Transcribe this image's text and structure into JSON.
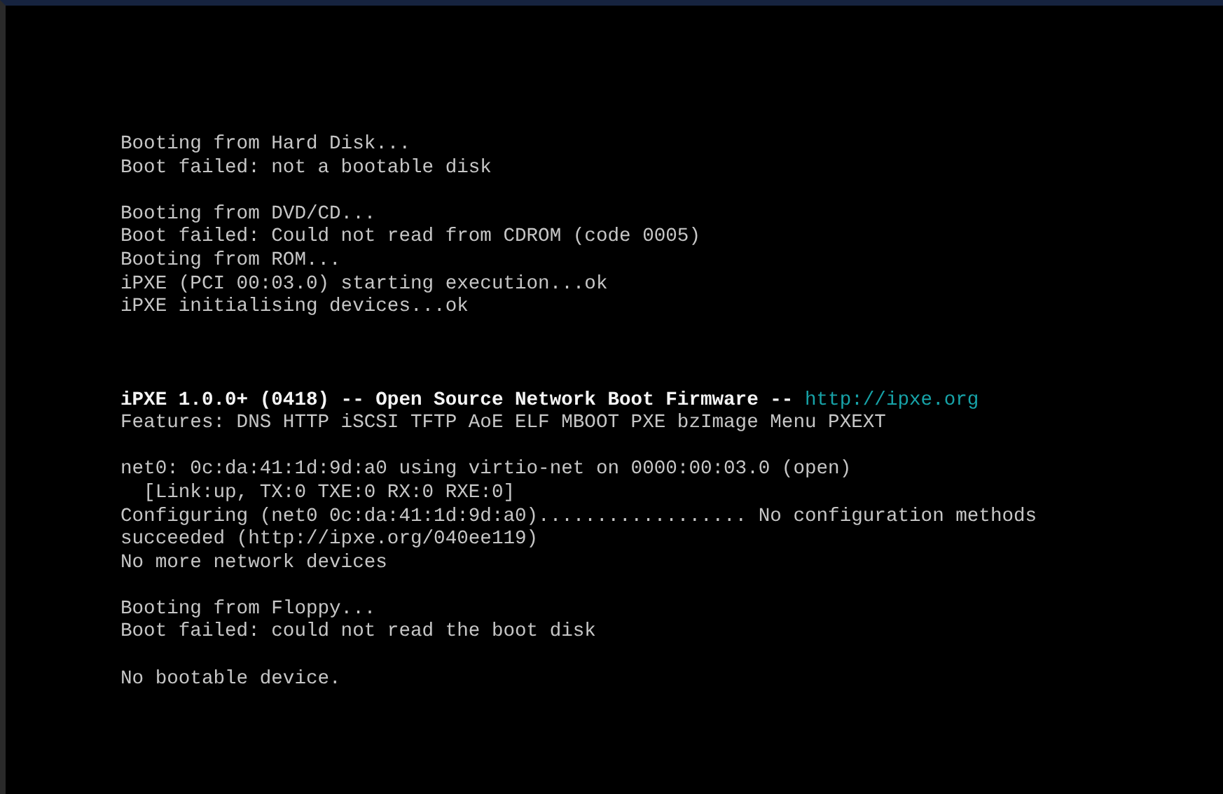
{
  "console": {
    "sections": [
      {
        "blocks": [
          {
            "lines": [
              {
                "text": "Booting from Hard Disk..."
              },
              {
                "text": "Boot failed: not a bootable disk"
              }
            ]
          },
          {
            "lines": [
              {
                "text": "Booting from DVD/CD..."
              },
              {
                "text": "Boot failed: Could not read from CDROM (code 0005)"
              },
              {
                "text": "Booting from ROM..."
              },
              {
                "text": "iPXE (PCI 00:03.0) starting execution...ok"
              },
              {
                "text": "iPXE initialising devices...ok"
              }
            ]
          }
        ]
      },
      {
        "blocks": [
          {
            "lines": [
              {
                "text": "iPXE 1.0.0+ (0418) -- Open Source Network Boot Firmware --",
                "bright": true,
                "link": "http://ipxe.org"
              },
              {
                "text": "Features: DNS HTTP iSCSI TFTP AoE ELF MBOOT PXE bzImage Menu PXEXT"
              }
            ]
          },
          {
            "lines": [
              {
                "text": "net0: 0c:da:41:1d:9d:a0 using virtio-net on 0000:00:03.0 (open)"
              },
              {
                "text": "  [Link:up, TX:0 TXE:0 RX:0 RXE:0]"
              },
              {
                "text": "Configuring (net0 0c:da:41:1d:9d:a0).................. No configuration methods"
              },
              {
                "text": "succeeded (http://ipxe.org/040ee119)"
              },
              {
                "text": "No more network devices"
              }
            ]
          },
          {
            "lines": [
              {
                "text": "Booting from Floppy..."
              },
              {
                "text": "Boot failed: could not read the boot disk"
              }
            ]
          },
          {
            "lines": [
              {
                "text": "No bootable device."
              }
            ]
          }
        ]
      }
    ]
  }
}
